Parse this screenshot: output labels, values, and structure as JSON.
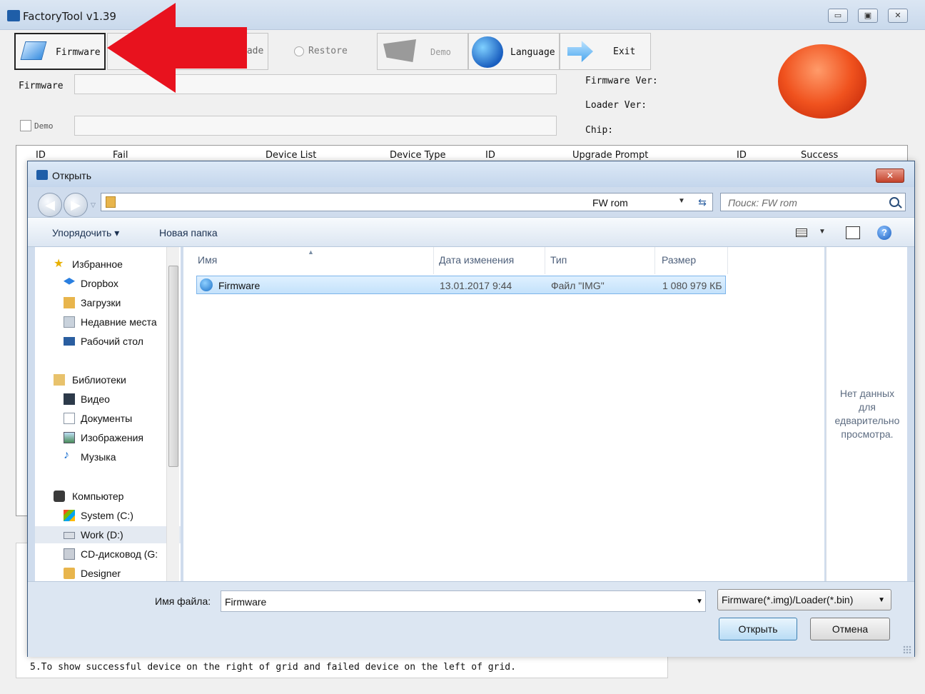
{
  "main_window": {
    "title": "FactoryTool v1.39",
    "toolbar": {
      "firmware": "Firmware",
      "upgrade": "rade",
      "restore": "Restore",
      "demo": "Demo",
      "language": "Language",
      "exit": "Exit"
    },
    "fields": {
      "firmware_label": "Firmware",
      "demo_checkbox_label": "Demo"
    },
    "info": {
      "firmware_ver": "Firmware Ver:",
      "loader_ver": "Loader Ver:",
      "chip": "Chip:"
    },
    "grid_headers_left": [
      "ID",
      "Fail"
    ],
    "grid_headers_mid": [
      "Device List",
      "Device Type",
      "ID",
      "Upgrade Prompt"
    ],
    "grid_headers_right": [
      "ID",
      "Success"
    ],
    "bottom_text": "5.To show successful device on the right of grid and failed device on the left of grid."
  },
  "dialog": {
    "title": "Открыть",
    "address_path": "FW rom",
    "search_placeholder": "Поиск: FW rom",
    "commands": {
      "organize": "Упорядочить ▾",
      "new_folder": "Новая папка"
    },
    "nav_items": [
      {
        "label": "Избранное",
        "icon": "star-icon"
      },
      {
        "label": "Dropbox",
        "icon": "dropbox-icon"
      },
      {
        "label": "Загрузки",
        "icon": "downloads-folder-icon"
      },
      {
        "label": "Недавние места",
        "icon": "recent-places-icon"
      },
      {
        "label": "Рабочий стол",
        "icon": "desktop-icon"
      },
      {
        "label": "Библиотеки",
        "icon": "libraries-icon"
      },
      {
        "label": "Видео",
        "icon": "video-icon"
      },
      {
        "label": "Документы",
        "icon": "documents-icon"
      },
      {
        "label": "Изображения",
        "icon": "pictures-icon"
      },
      {
        "label": "Музыка",
        "icon": "music-icon"
      },
      {
        "label": "Компьютер",
        "icon": "computer-icon"
      },
      {
        "label": "System (C:)",
        "icon": "system-drive-icon"
      },
      {
        "label": "Work (D:)",
        "icon": "drive-icon"
      },
      {
        "label": "CD-дисковод (G:",
        "icon": "cd-drive-icon"
      },
      {
        "label": "Designer",
        "icon": "designer-icon"
      }
    ],
    "columns": {
      "name": "Имя",
      "date": "Дата изменения",
      "type": "Тип",
      "size": "Размер"
    },
    "files": [
      {
        "name": "Firmware",
        "date": "13.01.2017 9:44",
        "type": "Файл \"IMG\"",
        "size": "1 080 979 КБ"
      }
    ],
    "preview_text": "Нет данных\nдля\nедварительно\nпросмотра.",
    "filename_label": "Имя файла:",
    "filename_value": "Firmware",
    "filter_value": "Firmware(*.img)/Loader(*.bin)",
    "open_button": "Открыть",
    "cancel_button": "Отмена"
  },
  "colors": {
    "dialog_frame": "#cfdced",
    "selection": "#c4e2fb",
    "red_arrow": "#e8121e",
    "big_button": "#f0521e"
  }
}
